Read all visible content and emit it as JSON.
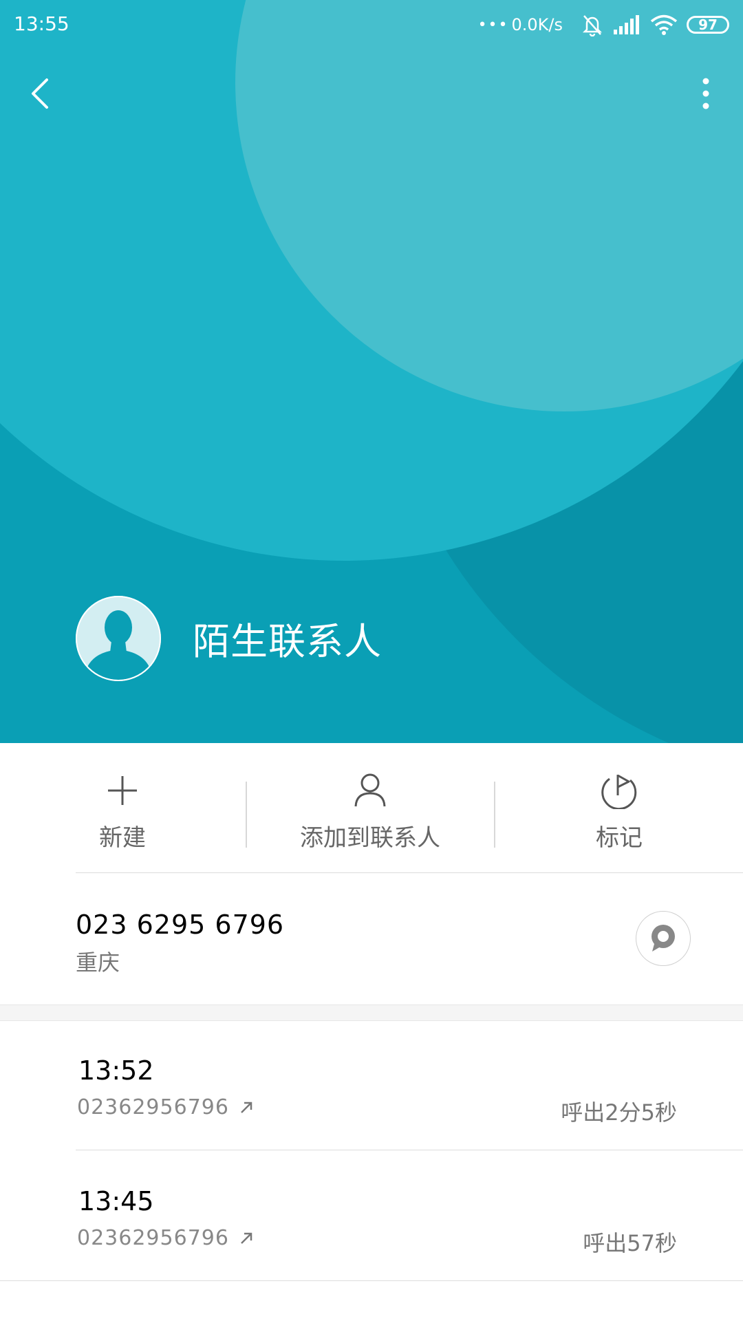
{
  "status_bar": {
    "time": "13:55",
    "dots": "•••",
    "net_speed": "0.0K/s",
    "battery": "97"
  },
  "header": {
    "back_icon": "chevron-left-icon",
    "more_icon": "more-vertical-icon",
    "contact_name": "陌生联系人",
    "colors": {
      "base": "#0a9fb5",
      "big_circle": "#1eb4c8",
      "top_circle": "#46bfcd",
      "dark_corner": "#0892a8"
    }
  },
  "actions": [
    {
      "icon": "plus-icon",
      "label": "新建"
    },
    {
      "icon": "person-icon",
      "label": "添加到联系人"
    },
    {
      "icon": "flag-icon",
      "label": "标记"
    }
  ],
  "number": {
    "phone": "023 6295 6796",
    "location": "重庆",
    "message_icon": "message-bubble-icon"
  },
  "call_log": [
    {
      "time": "13:52",
      "number": "02362956796",
      "direction_icon": "outgoing-arrow-icon",
      "duration": "呼出2分5秒"
    },
    {
      "time": "13:45",
      "number": "02362956796",
      "direction_icon": "outgoing-arrow-icon",
      "duration": "呼出57秒"
    }
  ]
}
